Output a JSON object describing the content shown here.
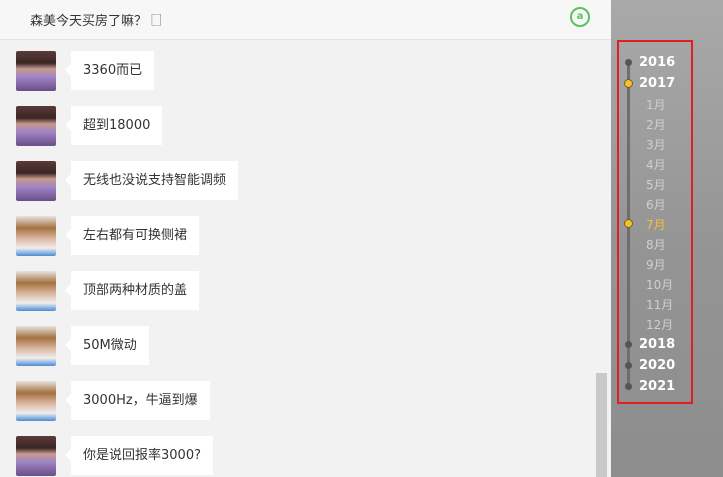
{
  "chat": {
    "title": "森美今天买房了嘛？ 🗌",
    "at_icon": "@all",
    "messages": [
      {
        "avatar": "avatar-masked-man",
        "text": "3360而已"
      },
      {
        "avatar": "avatar-masked-man",
        "text": "超到18000"
      },
      {
        "avatar": "avatar-masked-man",
        "text": "无线也没说支持智能调频"
      },
      {
        "avatar": "avatar-young-man",
        "text": "左右都有可换侧裙"
      },
      {
        "avatar": "avatar-young-man",
        "text": "顶部两种材质的盖"
      },
      {
        "avatar": "avatar-young-man",
        "text": "50M微动"
      },
      {
        "avatar": "avatar-young-man",
        "text": "3000Hz，牛逼到爆"
      },
      {
        "avatar": "avatar-masked-man",
        "text": "你是说回报率3000?"
      }
    ]
  },
  "timeline": {
    "items": [
      {
        "type": "year",
        "label": "2016",
        "active": false
      },
      {
        "type": "year",
        "label": "2017",
        "active": true
      },
      {
        "type": "month",
        "label": "1月",
        "active": false
      },
      {
        "type": "month",
        "label": "2月",
        "active": false
      },
      {
        "type": "month",
        "label": "3月",
        "active": false
      },
      {
        "type": "month",
        "label": "4月",
        "active": false
      },
      {
        "type": "month",
        "label": "5月",
        "active": false
      },
      {
        "type": "month",
        "label": "6月",
        "active": false
      },
      {
        "type": "month",
        "label": "7月",
        "active": true
      },
      {
        "type": "month",
        "label": "8月",
        "active": false
      },
      {
        "type": "month",
        "label": "9月",
        "active": false
      },
      {
        "type": "month",
        "label": "10月",
        "active": false
      },
      {
        "type": "month",
        "label": "11月",
        "active": false
      },
      {
        "type": "month",
        "label": "12月",
        "active": false
      },
      {
        "type": "year",
        "label": "2018",
        "active": false
      },
      {
        "type": "year",
        "label": "2020",
        "active": false
      },
      {
        "type": "year",
        "label": "2021",
        "active": false
      }
    ]
  },
  "colors": {
    "accent_green": "#5ac35a",
    "highlight_yellow": "#f3c033",
    "annotation_red": "#e02020"
  }
}
